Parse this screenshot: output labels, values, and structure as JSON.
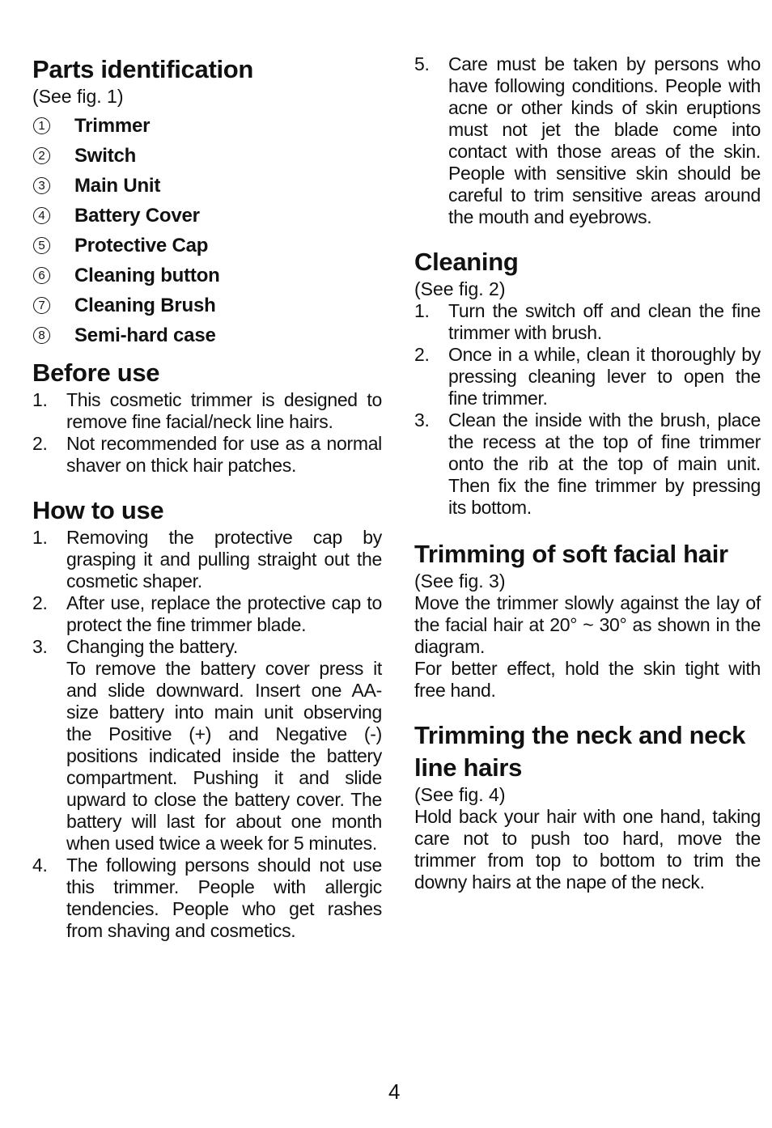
{
  "left": {
    "parts": {
      "title": "Parts identification",
      "see": "(See fig. 1)",
      "items": [
        {
          "num": "1",
          "label": "Trimmer"
        },
        {
          "num": "2",
          "label": "Switch"
        },
        {
          "num": "3",
          "label": "Main Unit"
        },
        {
          "num": "4",
          "label": "Battery Cover"
        },
        {
          "num": "5",
          "label": "Protective Cap"
        },
        {
          "num": "6",
          "label": "Cleaning button"
        },
        {
          "num": "7",
          "label": "Cleaning Brush"
        },
        {
          "num": "8",
          "label": "Semi-hard case"
        }
      ]
    },
    "before_use": {
      "title": "Before use",
      "steps": [
        {
          "num": "1.",
          "text": "This cosmetic trimmer is designed to remove fine facial/neck line hairs."
        },
        {
          "num": "2.",
          "text": "Not recommended for use as a normal shaver on thick hair patches."
        }
      ]
    },
    "how_to_use": {
      "title": "How to use",
      "steps": [
        {
          "num": "1.",
          "text": "Removing the protective cap by grasping it and pulling straight out the cosmetic shaper."
        },
        {
          "num": "2.",
          "text": "After use, replace the protective cap to protect the fine trimmer blade."
        },
        {
          "num": "3.",
          "text": "Changing the battery.",
          "detail": "To remove the battery cover press it and slide downward. Insert one AA-size battery into main unit observing the Positive (+) and Negative (-) positions indicated inside the battery compartment. Pushing it and slide upward to close the battery cover. The battery will last for about one month when used twice a week for 5 minutes."
        },
        {
          "num": "4.",
          "text": "The following persons should not use this trimmer. People with allergic tendencies. People who get rashes from shaving and cosmetics."
        }
      ]
    }
  },
  "right": {
    "step5": {
      "num": "5.",
      "text": "Care must be taken by persons who have following conditions. People with acne or other kinds of skin eruptions must not jet the blade come into contact with those areas of the skin. People with sensitive skin should be careful to trim sensitive areas around the mouth and eyebrows."
    },
    "cleaning": {
      "title": "Cleaning",
      "see": "(See fig. 2)",
      "steps": [
        {
          "num": "1.",
          "text": "Turn the switch off and clean the fine trimmer with brush."
        },
        {
          "num": "2.",
          "text": "Once in a while, clean it thoroughly by pressing cleaning lever to open the fine trimmer."
        },
        {
          "num": "3.",
          "text": "Clean the inside with the brush, place the recess at the top of fine trimmer onto the rib at the top of main unit. Then fix the fine trimmer by pressing its bottom."
        }
      ]
    },
    "soft_facial": {
      "title": "Trimming of soft facial hair",
      "see": "(See fig. 3)",
      "para1": "Move the trimmer slowly against the lay of the facial hair at 20° ~ 30° as shown in the diagram.",
      "para2": "For better effect, hold the skin tight with free hand."
    },
    "neck": {
      "title": "Trimming the neck and neck line hairs",
      "see": "(See fig. 4)",
      "para": "Hold back your hair with one hand, taking care not to push too hard, move the trimmer from top to bottom to trim the downy hairs at the nape of the neck."
    }
  },
  "page_number": "4"
}
